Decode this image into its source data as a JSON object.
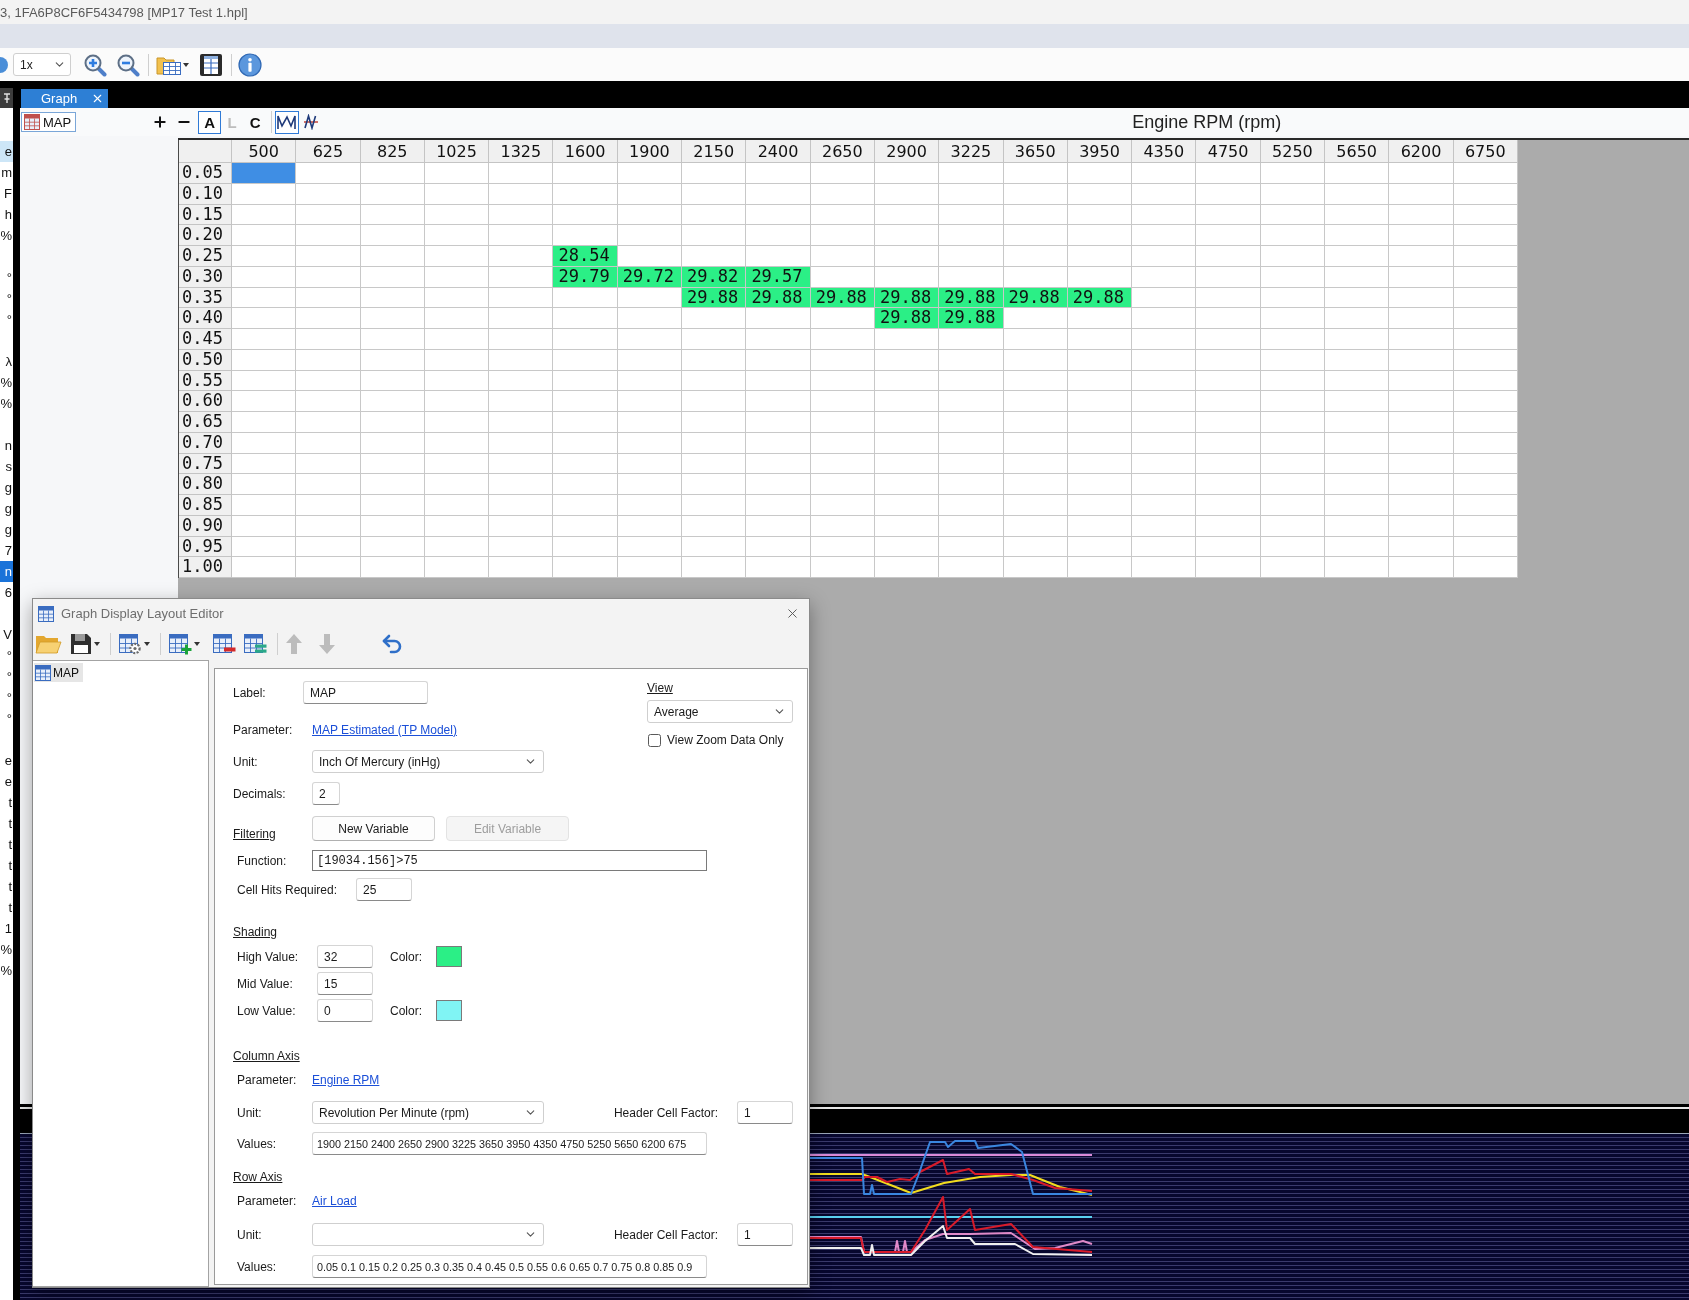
{
  "window": {
    "title": "3, 1FA6P8CF6F5434798 [MP17 Test 1.hpl]"
  },
  "toolbar": {
    "items": [
      {
        "kind": "round"
      },
      {
        "kind": "zoom_select",
        "value": "1x"
      },
      {
        "kind": "zoom_in"
      },
      {
        "kind": "zoom_out"
      },
      {
        "kind": "separator"
      },
      {
        "kind": "layout"
      },
      {
        "kind": "save_layout"
      },
      {
        "kind": "separator"
      },
      {
        "kind": "info"
      }
    ]
  },
  "side_panel": {
    "groups": [
      {
        "items": [
          {
            "text": "e",
            "selected": false,
            "highlighted": true
          },
          {
            "text": "m",
            "selected": false,
            "highlighted": false
          },
          {
            "text": "F",
            "selected": false,
            "highlighted": false
          },
          {
            "text": "h",
            "selected": false,
            "highlighted": false
          },
          {
            "text": "%",
            "selected": false,
            "highlighted": false
          }
        ]
      },
      {
        "items": [
          {
            "text": "°",
            "selected": false,
            "highlighted": false
          },
          {
            "text": "°",
            "selected": false,
            "highlighted": false
          },
          {
            "text": "°",
            "selected": false,
            "highlighted": false
          }
        ]
      },
      {
        "items": [
          {
            "text": "λ",
            "selected": false,
            "highlighted": false
          },
          {
            "text": "%",
            "selected": false,
            "highlighted": false
          },
          {
            "text": "%",
            "selected": false,
            "highlighted": false
          }
        ]
      },
      {
        "items": [
          {
            "text": "n",
            "selected": false,
            "highlighted": false
          },
          {
            "text": "s",
            "selected": false,
            "highlighted": false
          },
          {
            "text": "g",
            "selected": false,
            "highlighted": false
          },
          {
            "text": "g",
            "selected": false,
            "highlighted": false
          },
          {
            "text": "g",
            "selected": false,
            "highlighted": false
          },
          {
            "text": "7",
            "selected": false,
            "highlighted": false
          },
          {
            "text": "n",
            "selected": true,
            "highlighted": false
          },
          {
            "text": "6",
            "selected": false,
            "highlighted": false
          }
        ]
      },
      {
        "items": [
          {
            "text": "V",
            "selected": false,
            "highlighted": false
          },
          {
            "text": "°",
            "selected": false,
            "highlighted": false
          },
          {
            "text": "°",
            "selected": false,
            "highlighted": false
          },
          {
            "text": "°",
            "selected": false,
            "highlighted": false
          },
          {
            "text": "°",
            "selected": false,
            "highlighted": false
          }
        ]
      },
      {
        "items": [
          {
            "text": "e",
            "selected": false,
            "highlighted": false
          },
          {
            "text": "e",
            "selected": false,
            "highlighted": false
          },
          {
            "text": "t",
            "selected": false,
            "highlighted": false
          },
          {
            "text": "t",
            "selected": false,
            "highlighted": false
          },
          {
            "text": "t",
            "selected": false,
            "highlighted": false
          },
          {
            "text": "t",
            "selected": false,
            "highlighted": false
          },
          {
            "text": "t",
            "selected": false,
            "highlighted": false
          },
          {
            "text": "t",
            "selected": false,
            "highlighted": false
          },
          {
            "text": "1",
            "selected": false,
            "highlighted": false
          },
          {
            "text": "%",
            "selected": false,
            "highlighted": false
          },
          {
            "text": "%",
            "selected": false,
            "highlighted": false
          }
        ]
      }
    ]
  },
  "document_tab": {
    "label": "Graph",
    "selected": true
  },
  "graph_toolbar": {
    "table_button": {
      "label": "MAP"
    },
    "zoom_buttons": [
      {
        "kind": "plus"
      },
      {
        "kind": "minus"
      }
    ],
    "mode_buttons": [
      {
        "label": "A",
        "selected": true,
        "disabled": false
      },
      {
        "label": "L",
        "selected": false,
        "disabled": true
      },
      {
        "label": "C",
        "selected": false,
        "disabled": false
      }
    ],
    "view_buttons": [
      {
        "kind": "traces",
        "selected": true
      },
      {
        "kind": "split",
        "selected": false
      }
    ]
  },
  "axis_title": "Engine RPM (rpm)",
  "table": {
    "columns": [
      "500",
      "625",
      "825",
      "1025",
      "1325",
      "1600",
      "1900",
      "2150",
      "2400",
      "2650",
      "2900",
      "3225",
      "3650",
      "3950",
      "4350",
      "4750",
      "5250",
      "5650",
      "6200",
      "6750"
    ],
    "rows": [
      {
        "label": "0.05",
        "cells": [
          {
            "selected": true
          },
          null,
          null,
          null,
          null,
          null,
          null,
          null,
          null,
          null,
          null,
          null,
          null,
          null,
          null,
          null,
          null,
          null,
          null,
          null
        ]
      },
      {
        "label": "0.10"
      },
      {
        "label": "0.15"
      },
      {
        "label": "0.20"
      },
      {
        "label": "0.25",
        "cells": [
          null,
          null,
          null,
          null,
          null,
          {
            "value": "28.54",
            "selected": false
          },
          null,
          null,
          null,
          null,
          null,
          null,
          null,
          null,
          null,
          null,
          null,
          null,
          null,
          null
        ]
      },
      {
        "label": "0.30",
        "cells": [
          null,
          null,
          null,
          null,
          null,
          {
            "value": "29.79",
            "selected": false
          },
          {
            "value": "29.72",
            "selected": false
          },
          {
            "value": "29.82",
            "selected": false
          },
          {
            "value": "29.57",
            "selected": false
          },
          null,
          null,
          null,
          null,
          null,
          null,
          null,
          null,
          null,
          null,
          null
        ]
      },
      {
        "label": "0.35",
        "cells": [
          null,
          null,
          null,
          null,
          null,
          null,
          null,
          {
            "value": "29.88",
            "selected": false
          },
          {
            "value": "29.88",
            "selected": false
          },
          {
            "value": "29.88",
            "selected": false
          },
          {
            "value": "29.88",
            "selected": false
          },
          {
            "value": "29.88",
            "selected": false
          },
          {
            "value": "29.88",
            "selected": false
          },
          {
            "value": "29.88",
            "selected": false
          },
          null,
          null,
          null,
          null,
          null,
          null
        ]
      },
      {
        "label": "0.40",
        "cells": [
          null,
          null,
          null,
          null,
          null,
          null,
          null,
          null,
          null,
          null,
          {
            "value": "29.88",
            "selected": false
          },
          {
            "value": "29.88",
            "selected": false
          },
          null,
          null,
          null,
          null,
          null,
          null,
          null,
          null
        ]
      },
      {
        "label": "0.45"
      },
      {
        "label": "0.50"
      },
      {
        "label": "0.55"
      },
      {
        "label": "0.60"
      },
      {
        "label": "0.65"
      },
      {
        "label": "0.70"
      },
      {
        "label": "0.75"
      },
      {
        "label": "0.80"
      },
      {
        "label": "0.85"
      },
      {
        "label": "0.90"
      },
      {
        "label": "0.95"
      },
      {
        "label": "1.00"
      }
    ]
  },
  "dialog": {
    "title": "Graph Display Layout Editor",
    "toolbar": [
      {
        "kind": "open",
        "dropdown": false,
        "disabled": false
      },
      {
        "kind": "save",
        "dropdown": true,
        "disabled": false
      },
      {
        "kind": "separator"
      },
      {
        "kind": "settings",
        "dropdown": true,
        "disabled": false
      },
      {
        "kind": "separator"
      },
      {
        "kind": "add",
        "dropdown": true,
        "disabled": false
      },
      {
        "kind": "remove",
        "dropdown": false,
        "disabled": false
      },
      {
        "kind": "edit",
        "dropdown": false,
        "disabled": false
      },
      {
        "kind": "separator"
      },
      {
        "kind": "move_up",
        "dropdown": false,
        "disabled": true
      },
      {
        "kind": "move_down",
        "dropdown": false,
        "disabled": true
      },
      {
        "kind": "undo",
        "dropdown": false,
        "disabled": false
      }
    ],
    "tree": [
      {
        "label": "MAP",
        "selected": true
      }
    ],
    "form": {
      "label": {
        "label": "Label:",
        "value": "MAP"
      },
      "parameter": {
        "label": "Parameter:",
        "link": "MAP Estimated (TP Model)"
      },
      "unit": {
        "label": "Unit:",
        "value": "Inch Of Mercury (inHg)"
      },
      "decimals": {
        "label": "Decimals:",
        "value": "2"
      },
      "view": {
        "heading": "View",
        "value": "Average",
        "zoom_only": {
          "label": "View Zoom Data Only",
          "checked": false
        }
      },
      "filtering": {
        "heading": "Filtering",
        "buttons": [
          {
            "label": "New Variable",
            "disabled": false
          },
          {
            "label": "Edit Variable",
            "disabled": true
          }
        ],
        "function": {
          "label": "Function:",
          "value": "[19034.156]>75"
        },
        "cell_hits": {
          "label": "Cell Hits Required:",
          "value": "25"
        }
      },
      "shading": {
        "heading": "Shading",
        "levels": [
          {
            "label": "High Value:",
            "value": "32",
            "color_label": "Color:",
            "color": "#2bef86"
          },
          {
            "label": "Mid Value:",
            "value": "15"
          },
          {
            "label": "Low Value:",
            "value": "0",
            "color_label": "Color:",
            "color": "#80f4f4"
          }
        ]
      },
      "axes": [
        {
          "heading": "Column Axis",
          "parameter": {
            "label": "Parameter:",
            "link": "Engine RPM"
          },
          "unit": {
            "label": "Unit:",
            "value": "Revolution Per Minute (rpm)"
          },
          "header_factor": {
            "label": "Header Cell Factor:",
            "value": "1"
          },
          "values": {
            "label": "Values:",
            "value": "1900 2150 2400 2650 2900 3225 3650 3950 4350 4750 5250 5650 6200 675"
          }
        },
        {
          "heading": "Row Axis",
          "parameter": {
            "label": "Parameter:",
            "link": "Air Load"
          },
          "unit": {
            "label": "Unit:"
          },
          "header_factor": {
            "label": "Header Cell Factor:",
            "value": "1"
          },
          "values": {
            "label": "Values:",
            "value": "0.05 0.1 0.15 0.2 0.25 0.3 0.35 0.4 0.45 0.5 0.55 0.6 0.65 0.7 0.75 0.8 0.85 0.9"
          }
        }
      ]
    }
  }
}
